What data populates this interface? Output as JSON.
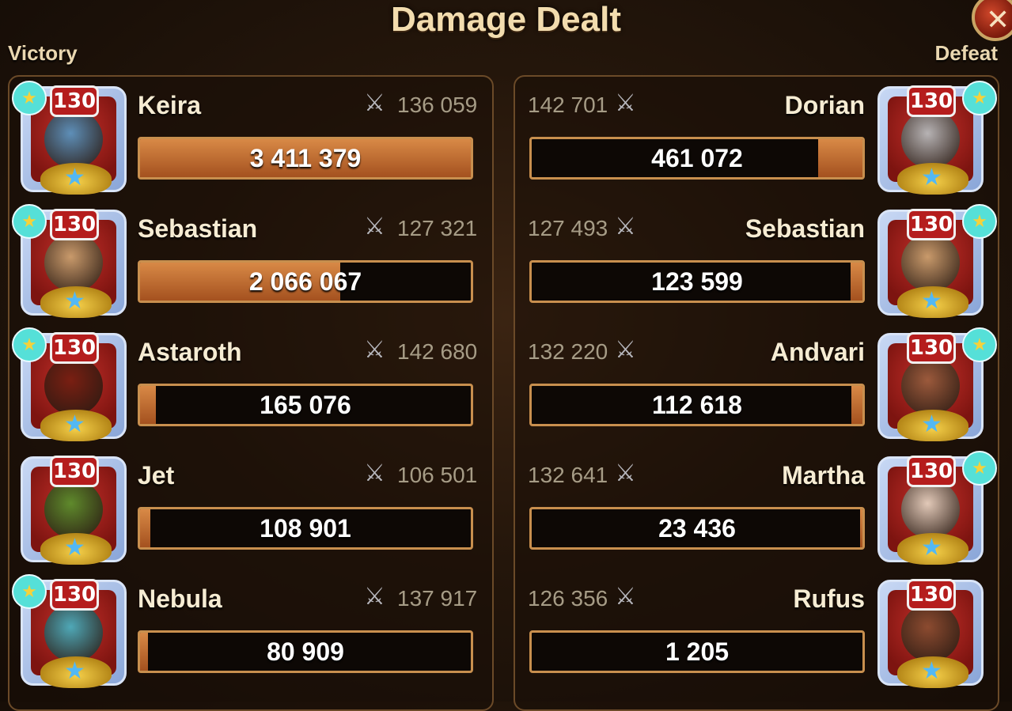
{
  "title": "Damage Dealt",
  "left_label": "Victory",
  "right_label": "Defeat",
  "close_icon": "close-icon",
  "victory_team": [
    {
      "name": "Keira",
      "level": "130",
      "power": "136 059",
      "damage": "3 411 379",
      "fill": 1.0,
      "pet": true,
      "face_color": "#5e8fb8"
    },
    {
      "name": "Sebastian",
      "level": "130",
      "power": "127 321",
      "damage": "2 066 067",
      "fill": 0.606,
      "pet": true,
      "face_color": "#c99a6b"
    },
    {
      "name": "Astaroth",
      "level": "130",
      "power": "142 680",
      "damage": "165 076",
      "fill": 0.048,
      "pet": true,
      "face_color": "#7a1f12"
    },
    {
      "name": "Jet",
      "level": "130",
      "power": "106 501",
      "damage": "108 901",
      "fill": 0.032,
      "pet": false,
      "face_color": "#5f8a2c"
    },
    {
      "name": "Nebula",
      "level": "130",
      "power": "137 917",
      "damage": "80 909",
      "fill": 0.024,
      "pet": true,
      "face_color": "#4fa8b7"
    }
  ],
  "defeat_team": [
    {
      "name": "Dorian",
      "level": "130",
      "power": "142 701",
      "damage": "461 072",
      "fill": 0.135,
      "pet": true,
      "face_color": "#b7b3b4"
    },
    {
      "name": "Sebastian",
      "level": "130",
      "power": "127 493",
      "damage": "123 599",
      "fill": 0.036,
      "pet": true,
      "face_color": "#c99a6b"
    },
    {
      "name": "Andvari",
      "level": "130",
      "power": "132 220",
      "damage": "112 618",
      "fill": 0.033,
      "pet": true,
      "face_color": "#9c5a3c"
    },
    {
      "name": "Martha",
      "level": "130",
      "power": "132 641",
      "damage": "23 436",
      "fill": 0.007,
      "pet": true,
      "face_color": "#e2c9b8"
    },
    {
      "name": "Rufus",
      "level": "130",
      "power": "126 356",
      "damage": "1 205",
      "fill": 0.0,
      "pet": false,
      "face_color": "#8c4b30"
    }
  ]
}
